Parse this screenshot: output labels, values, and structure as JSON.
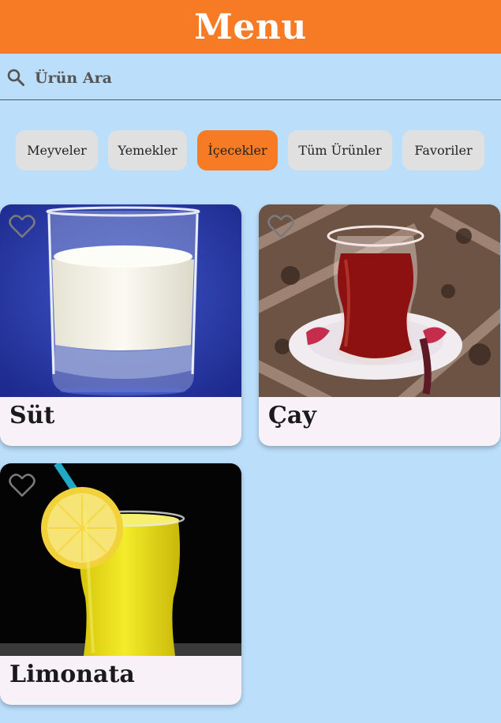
{
  "header": {
    "title": "Menu"
  },
  "search": {
    "placeholder": "Ürün Ara",
    "value": ""
  },
  "categories": [
    {
      "label": "Meyveler",
      "active": false
    },
    {
      "label": "Yemekler",
      "active": false
    },
    {
      "label": "İçecekler",
      "active": true
    },
    {
      "label": "Tüm Ürünler",
      "active": false
    },
    {
      "label": "Favoriler",
      "active": false
    }
  ],
  "products": [
    {
      "name": "Süt",
      "favorite": false
    },
    {
      "name": "Çay",
      "favorite": false
    },
    {
      "name": "Limonata",
      "favorite": false
    }
  ],
  "colors": {
    "accent": "#f77b25",
    "background": "#bbdefa",
    "chip": "#e0e0e0",
    "card": "#f8f1f8"
  }
}
